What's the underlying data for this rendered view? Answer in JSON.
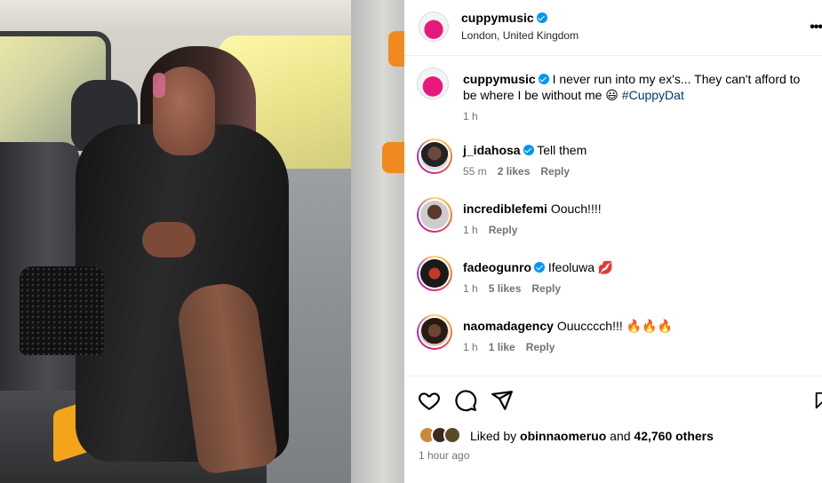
{
  "post": {
    "author": "cuppymusic",
    "location": "London, United Kingdom",
    "caption_user": "cuppymusic",
    "caption_text": "I never run into my ex's... They can't afford to be where I be without me 😃",
    "caption_hashtag": "#CuppyDat",
    "caption_time": "1 h"
  },
  "comments": [
    {
      "user": "j_idahosa",
      "verified": true,
      "text": "Tell them",
      "time": "55 m",
      "likes": "2 likes",
      "reply": "Reply"
    },
    {
      "user": "incrediblefemi",
      "verified": false,
      "text": "Oouch!!!!",
      "time": "1 h",
      "likes": "",
      "reply": "Reply"
    },
    {
      "user": "fadeogunro",
      "verified": true,
      "text": "Ifeoluwa 💋",
      "time": "1 h",
      "likes": "5 likes",
      "reply": "Reply"
    },
    {
      "user": "naomadagency",
      "verified": false,
      "text": "Ouucccch!!! 🔥🔥🔥",
      "time": "1 h",
      "likes": "1 like",
      "reply": "Reply"
    }
  ],
  "likes": {
    "prefix": "Liked by",
    "user": "obinnaomeruo",
    "middle": "and",
    "others": "42,760 others",
    "timestamp": "1 hour ago"
  },
  "icons": {
    "more": "more-options-icon",
    "like": "heart-icon",
    "comment": "comment-icon",
    "share": "share-icon",
    "save": "bookmark-icon"
  },
  "colors": {
    "verified": "#0095f6",
    "hashtag": "#00376b",
    "meta": "#737373"
  }
}
